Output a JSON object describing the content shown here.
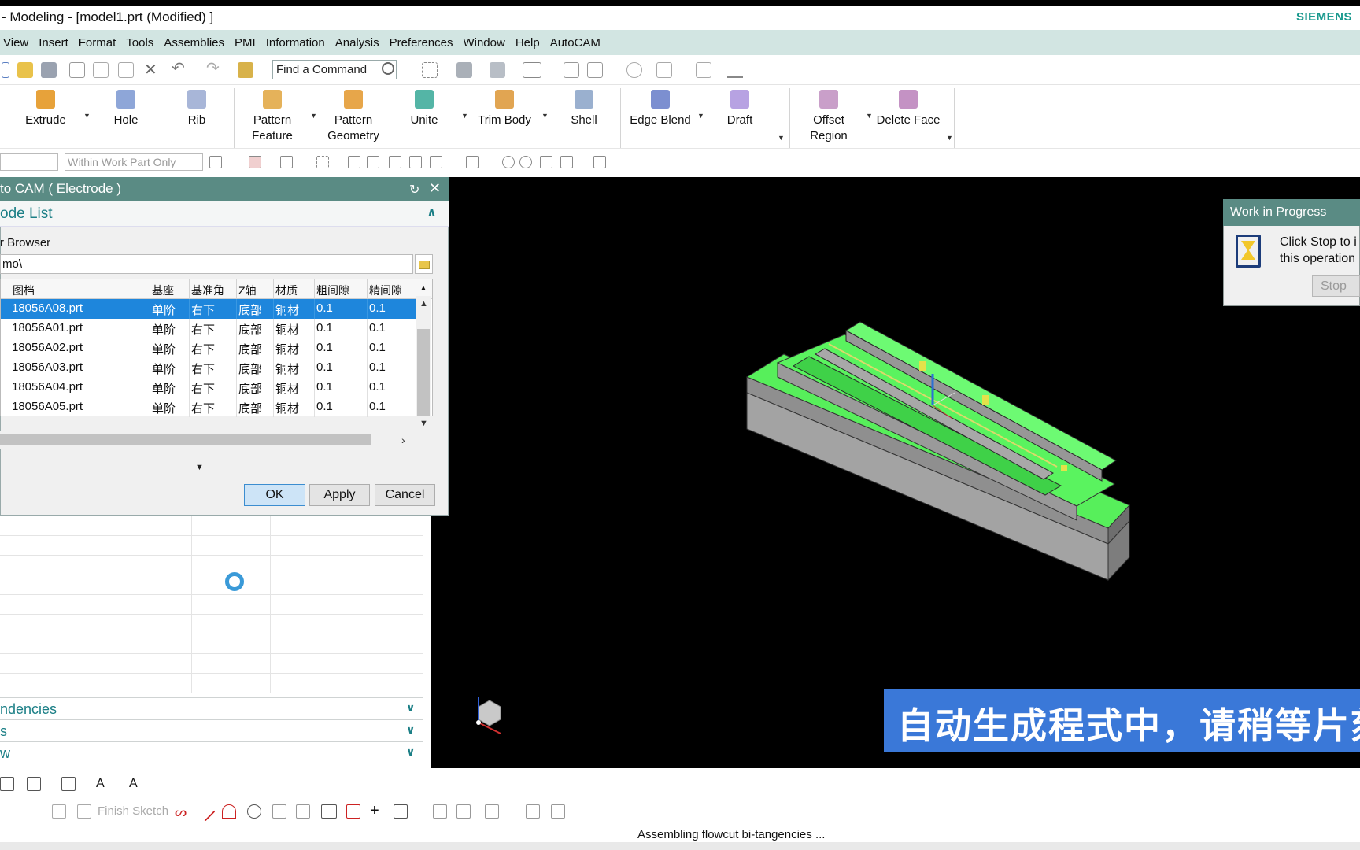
{
  "window": {
    "title": "- Modeling - [model1.prt (Modified) ]",
    "brand": "SIEMENS"
  },
  "menu": [
    "View",
    "Insert",
    "Format",
    "Tools",
    "Assemblies",
    "PMI",
    "Information",
    "Analysis",
    "Preferences",
    "Window",
    "Help",
    "AutoCAM"
  ],
  "quick_toolbar": {
    "find_command": "Find a Command"
  },
  "ribbon": {
    "extrude": "Extrude",
    "hole": "Hole",
    "rib": "Rib",
    "pattern_feature": "Pattern Feature",
    "pattern_geometry": "Pattern Geometry",
    "unite": "Unite",
    "trim_body": "Trim Body",
    "shell": "Shell",
    "edge_blend": "Edge Blend",
    "draft": "Draft",
    "offset_region": "Offset Region",
    "delete_face": "Delete Face"
  },
  "selection_bar": {
    "scope": "Within Work Part Only"
  },
  "dialog": {
    "title": "to CAM ( Electrode )",
    "section": "ode List",
    "browser_label": "r Browser",
    "path": "mo\\",
    "columns": [
      "图档",
      "基座",
      "基准角",
      "Z轴",
      "材质",
      "粗间隙",
      "精间隙"
    ],
    "rows": [
      [
        "18056A08.prt",
        "单阶",
        "右下",
        "底部",
        "铜材",
        "0.1",
        "0.1"
      ],
      [
        "18056A01.prt",
        "单阶",
        "右下",
        "底部",
        "铜材",
        "0.1",
        "0.1"
      ],
      [
        "18056A02.prt",
        "单阶",
        "右下",
        "底部",
        "铜材",
        "0.1",
        "0.1"
      ],
      [
        "18056A03.prt",
        "单阶",
        "右下",
        "底部",
        "铜材",
        "0.1",
        "0.1"
      ],
      [
        "18056A04.prt",
        "单阶",
        "右下",
        "底部",
        "铜材",
        "0.1",
        "0.1"
      ],
      [
        "18056A05.prt",
        "单阶",
        "右下",
        "底部",
        "铜材",
        "0.1",
        "0.1"
      ]
    ],
    "selected_row": 0,
    "ok": "OK",
    "apply": "Apply",
    "cancel": "Cancel"
  },
  "navigator": {
    "sections": [
      "ndencies",
      "s",
      "w"
    ]
  },
  "sketch_bar": {
    "finish_sketch": "Finish Sketch"
  },
  "work_in_progress": {
    "title": "Work in Progress",
    "message_line1": "Click Stop to i",
    "message_line2": "this operation",
    "stop": "Stop"
  },
  "caption": "自动生成程式中，请稍等片刻",
  "status": "Assembling flowcut bi-tangencies ...",
  "colors": {
    "menubar": "#d2e5e2",
    "dialog_title": "#5a8b84",
    "selection": "#1e86dc",
    "model_green": "#55f05a",
    "caption_bg": "#3a78d8",
    "brand": "#19998e"
  }
}
